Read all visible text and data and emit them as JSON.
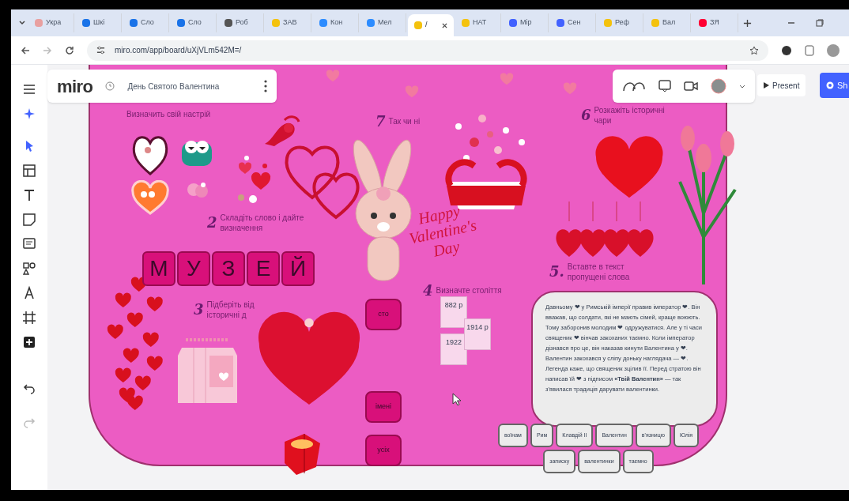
{
  "browser": {
    "tabs": [
      {
        "label": "Укра",
        "color": "#e8a0a0",
        "selected": false
      },
      {
        "label": "Шкі",
        "color": "#1a73e8",
        "selected": false
      },
      {
        "label": "Сло",
        "color": "#1a73e8",
        "selected": false
      },
      {
        "label": "Сло",
        "color": "#1a73e8",
        "selected": false
      },
      {
        "label": "Роб",
        "color": "#555555",
        "selected": false
      },
      {
        "label": "ЗАВ",
        "color": "#f4c20d",
        "selected": false
      },
      {
        "label": "Кон",
        "color": "#2d8cff",
        "selected": false
      },
      {
        "label": "Мел",
        "color": "#2d8cff",
        "selected": false
      },
      {
        "label": "/",
        "color": "#f4c20d",
        "selected": true
      },
      {
        "label": "НАТ",
        "color": "#f4c20d",
        "selected": false
      },
      {
        "label": "Мір",
        "color": "#4262ff",
        "selected": false
      },
      {
        "label": "Сен",
        "color": "#4262ff",
        "selected": false
      },
      {
        "label": "Реф",
        "color": "#f4c20d",
        "selected": false
      },
      {
        "label": "Вал",
        "color": "#f4c20d",
        "selected": false
      },
      {
        "label": "ЗЯ",
        "color": "#ff0033",
        "selected": false
      }
    ],
    "address": "miro.com/app/board/uXjVLm542M=/"
  },
  "miro": {
    "logo": "miro",
    "board_title": "День Святого Валентина",
    "present_button": "Present",
    "share_button": "Sh"
  },
  "board": {
    "tasks": [
      {
        "title": "Визначить свій настрій"
      },
      {
        "number": "7",
        "title": "Так чи ні"
      },
      {
        "number": "6",
        "title": "Розкажіть історичні чари"
      },
      {
        "number": "2",
        "title": "Складіть слово і дайте визначення"
      },
      {
        "number": "3",
        "title": "Підберіть від історичні д"
      },
      {
        "number": "4",
        "title": "Визначте століття"
      },
      {
        "number": "5.",
        "title": "Вставте в текст пропущені слова"
      }
    ],
    "word_tiles": [
      "М",
      "У",
      "З",
      "Е",
      "Й"
    ],
    "greeting": "Happy Valentine's Day",
    "date_cards": [
      "882 р",
      "1922",
      "1914 р"
    ],
    "answer_chips": [
      "сто",
      "імені",
      "усіх"
    ],
    "story": "Давньому ❤ у Римській імперії правив імператор ❤. Він вважав, що солдати, які не мають сімей, краще воюють. Тому заборонив молодим ❤ одружуватися. Але у ті часи священик ❤ вінчав закоханих таємно. Коли імператор дізнався про це, він наказав кинути Валентина у ❤. Валентин закохався у сліпу доньку наглядача — ❤. Легенда каже, що священик зцілив її. Перед стратою він написав їй ❤ з підписом **«Твій Валентин»** — так з'явилася традиція дарувати валентинки.",
    "word_bank": [
      "воїнам",
      "Рим",
      "Клавдій II",
      "Валентин",
      "в'язницю",
      "Юлія",
      "записку",
      "валентинки",
      "таємно"
    ]
  }
}
